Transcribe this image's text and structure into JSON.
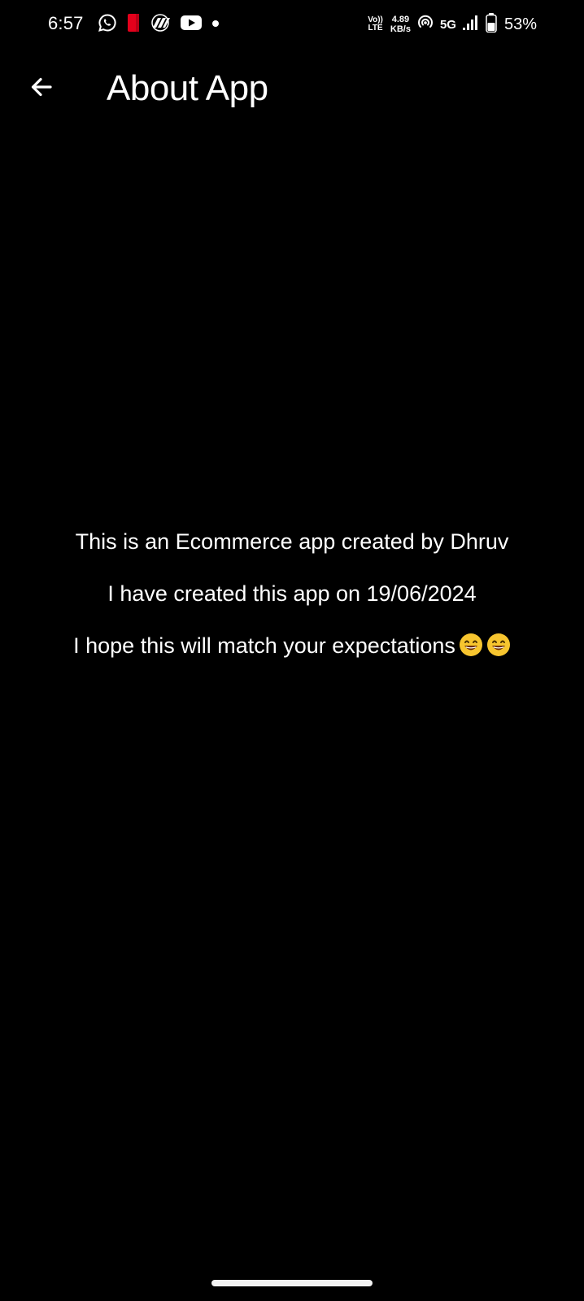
{
  "status_bar": {
    "time": "6:57",
    "left_icons": [
      "whatsapp-icon",
      "red-app-icon",
      "link-app-icon",
      "youtube-icon",
      "notification-dot-icon"
    ],
    "volte_top": "Vo))",
    "volte_bottom": "LTE",
    "net_speed_value": "4.89",
    "net_speed_unit": "KB/s",
    "network_type": "5G",
    "battery_percent": "53%"
  },
  "app_bar": {
    "title": "About App",
    "back_icon": "arrow-left-icon"
  },
  "content": {
    "line1": "This is an Ecommerce app created by Dhruv",
    "line2": "I have created this app on 19/06/2024",
    "line3": "I hope this will match your expectations",
    "line3_emojis": [
      "grinning-face-emoji",
      "grinning-face-emoji"
    ]
  },
  "colors": {
    "background": "#000000",
    "text": "#ffffff",
    "red_icon": "#e3001b",
    "emoji_face": "#f7c52f"
  }
}
